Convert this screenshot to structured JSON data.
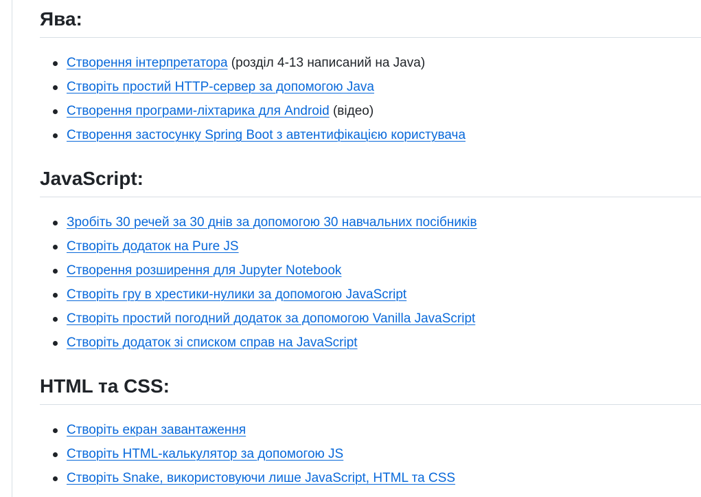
{
  "sections": [
    {
      "heading": "Ява:",
      "items": [
        {
          "link": "Створення інтерпретатора",
          "note": " (розділ 4-13 написаний на Java)"
        },
        {
          "link": "Створіть простий HTTP-сервер за допомогою Java",
          "note": ""
        },
        {
          "link": "Створення програми-ліхтарика для Android",
          "note": " (відео)"
        },
        {
          "link": "Створення застосунку Spring Boot з автентифікацією користувача",
          "note": ""
        }
      ]
    },
    {
      "heading": "JavaScript:",
      "items": [
        {
          "link": "Зробіть 30 речей за 30 днів за допомогою 30 навчальних посібників",
          "note": ""
        },
        {
          "link": "Створіть додаток на Pure JS",
          "note": ""
        },
        {
          "link": "Створення розширення для Jupyter Notebook",
          "note": ""
        },
        {
          "link": "Створіть гру в хрестики-нулики за допомогою JavaScript",
          "note": ""
        },
        {
          "link": "Створіть простий погодний додаток за допомогою Vanilla JavaScript",
          "note": ""
        },
        {
          "link": "Створіть додаток зі списком справ на JavaScript",
          "note": ""
        }
      ]
    },
    {
      "heading": "HTML та CSS:",
      "items": [
        {
          "link": "Створіть екран завантаження",
          "note": ""
        },
        {
          "link": "Створіть HTML-калькулятор за допомогою JS",
          "note": ""
        },
        {
          "link": "Створіть Snake, використовуючи лише JavaScript, HTML та CSS",
          "note": ""
        }
      ]
    }
  ]
}
